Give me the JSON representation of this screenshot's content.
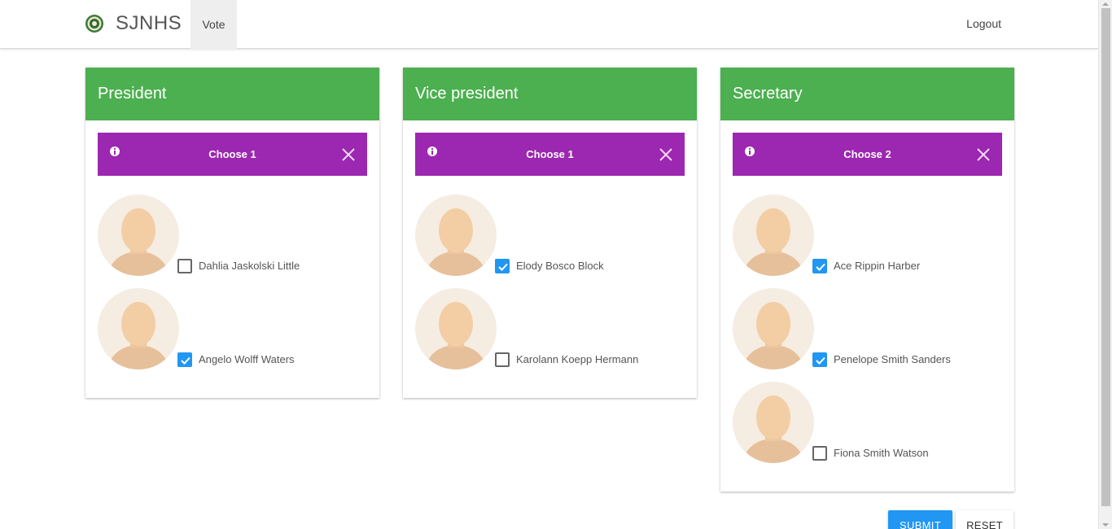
{
  "navbar": {
    "brand": "SJNHS",
    "nav_item": "Vote",
    "logout": "Logout"
  },
  "colors": {
    "card_header": "#4caf50",
    "alert": "#9c27b0",
    "checkbox_checked": "#2196f3",
    "submit": "#2196f3"
  },
  "positions": [
    {
      "title": "President",
      "alert": "Choose 1",
      "candidates": [
        {
          "name": "Dahlia Jaskolski Little",
          "checked": false
        },
        {
          "name": "Angelo Wolff Waters",
          "checked": true
        }
      ]
    },
    {
      "title": "Vice president",
      "alert": "Choose 1",
      "candidates": [
        {
          "name": "Elody Bosco Block",
          "checked": true
        },
        {
          "name": "Karolann Koepp Hermann",
          "checked": false
        }
      ]
    },
    {
      "title": "Secretary",
      "alert": "Choose 2",
      "candidates": [
        {
          "name": "Ace Rippin Harber",
          "checked": true
        },
        {
          "name": "Penelope Smith Sanders",
          "checked": true
        },
        {
          "name": "Fiona Smith Watson",
          "checked": false
        }
      ]
    }
  ],
  "actions": {
    "submit": "SUBMIT",
    "reset": "RESET"
  }
}
